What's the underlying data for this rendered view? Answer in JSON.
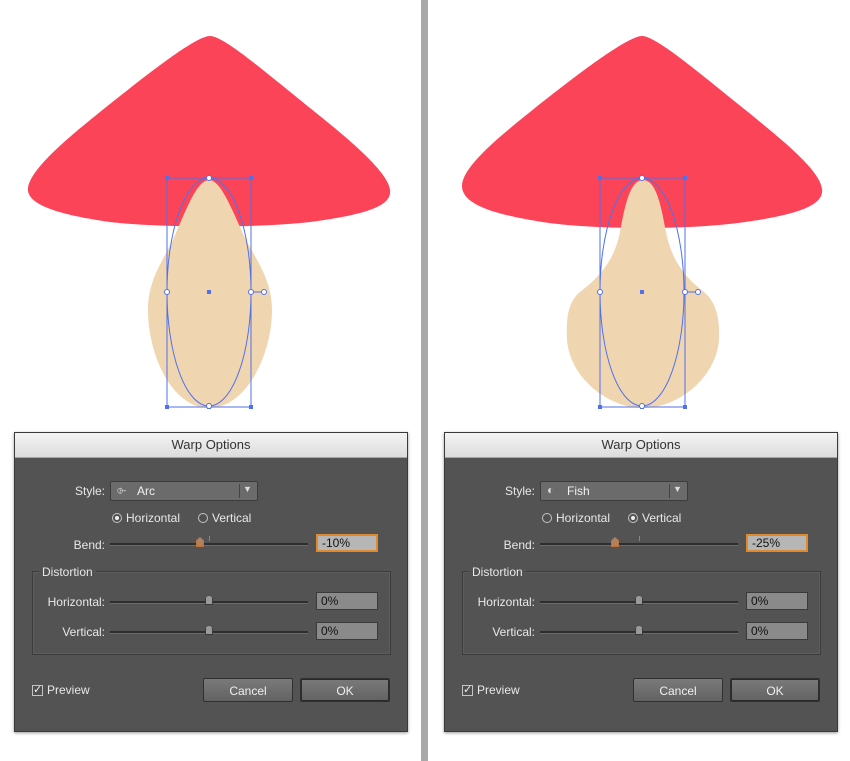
{
  "colors": {
    "cap": "#fc4459",
    "stem": "#f0d5b1",
    "selection": "#5071ea"
  },
  "panels": [
    {
      "dialog": {
        "title": "Warp Options",
        "style_label": "Style:",
        "style_icon": "arc-style-icon",
        "style_value": "Arc",
        "orientation": {
          "horizontal": "Horizontal",
          "vertical": "Vertical",
          "selected": "horizontal"
        },
        "bend_label": "Bend:",
        "bend_value": "-10%",
        "bend": -10,
        "distortion": {
          "legend": "Distortion",
          "horizontal_label": "Horizontal:",
          "horizontal_value": "0%",
          "vertical_label": "Vertical:",
          "vertical_value": "0%"
        },
        "preview_label": "Preview",
        "preview_checked": true,
        "cancel_label": "Cancel",
        "ok_label": "OK"
      }
    },
    {
      "dialog": {
        "title": "Warp Options",
        "style_label": "Style:",
        "style_icon": "fish-style-icon",
        "style_value": "Fish",
        "orientation": {
          "horizontal": "Horizontal",
          "vertical": "Vertical",
          "selected": "vertical"
        },
        "bend_label": "Bend:",
        "bend_value": "-25%",
        "bend": -25,
        "distortion": {
          "legend": "Distortion",
          "horizontal_label": "Horizontal:",
          "horizontal_value": "0%",
          "vertical_label": "Vertical:",
          "vertical_value": "0%"
        },
        "preview_label": "Preview",
        "preview_checked": true,
        "cancel_label": "Cancel",
        "ok_label": "OK"
      }
    }
  ]
}
